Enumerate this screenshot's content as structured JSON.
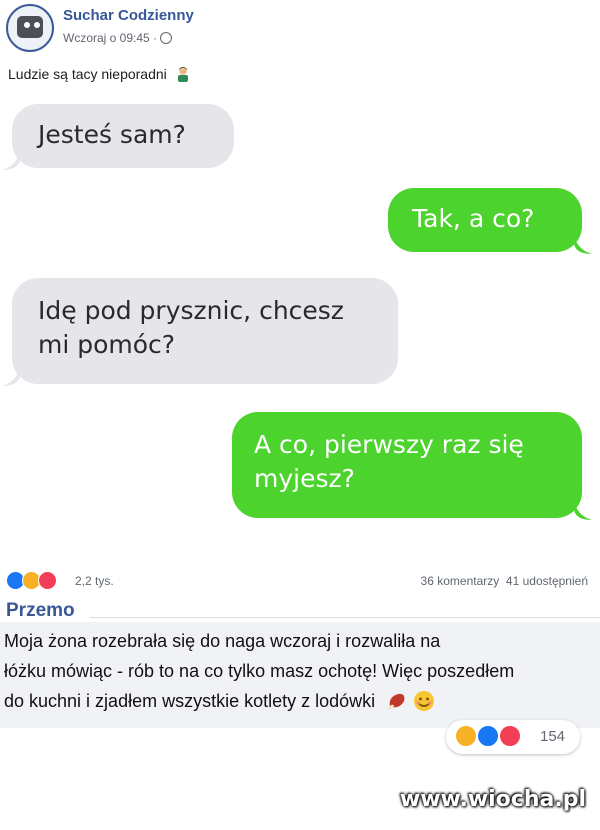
{
  "post": {
    "page_name": "Suchar Codzienny",
    "time": "Wczoraj o 09:45 ·",
    "caption": "Ludzie są tacy nieporadni",
    "caption_emoji": "man-facepalming-icon"
  },
  "chat": {
    "messages": [
      {
        "side": "in",
        "text": "Jesteś sam?"
      },
      {
        "side": "out",
        "text": "Tak, a co?"
      },
      {
        "side": "in",
        "line1": "Idę pod prysznic, chcesz",
        "line2": "mi pomóc?"
      },
      {
        "side": "out",
        "line1": "A co, pierwszy raz się",
        "line2": "myjesz?"
      }
    ],
    "colors": {
      "incoming": "#e5e5ea",
      "outgoing": "#4cd32e"
    }
  },
  "reactions": {
    "icons": [
      "like-icon",
      "haha-icon",
      "love-icon"
    ],
    "count": "2,2 tys.",
    "comments": "36 komentarzy",
    "shares": "41 udostępnień"
  },
  "comment": {
    "author": "Przemo",
    "line1": "Moja żona rozebrała się do naga wczoraj i rozwaliła na",
    "line2": "łóżku mówiąc - rób to na co tylko masz ochotę! Więc poszedłem",
    "line3": "do kuchni i zjadłem wszystkie kotlety z lodówki",
    "emojis": [
      "meat-icon",
      "smiling-face-icon"
    ],
    "reactions": {
      "icons": [
        "haha-icon",
        "like-icon",
        "love-icon"
      ],
      "count": "154"
    }
  },
  "watermark": "www.wiocha.pl"
}
